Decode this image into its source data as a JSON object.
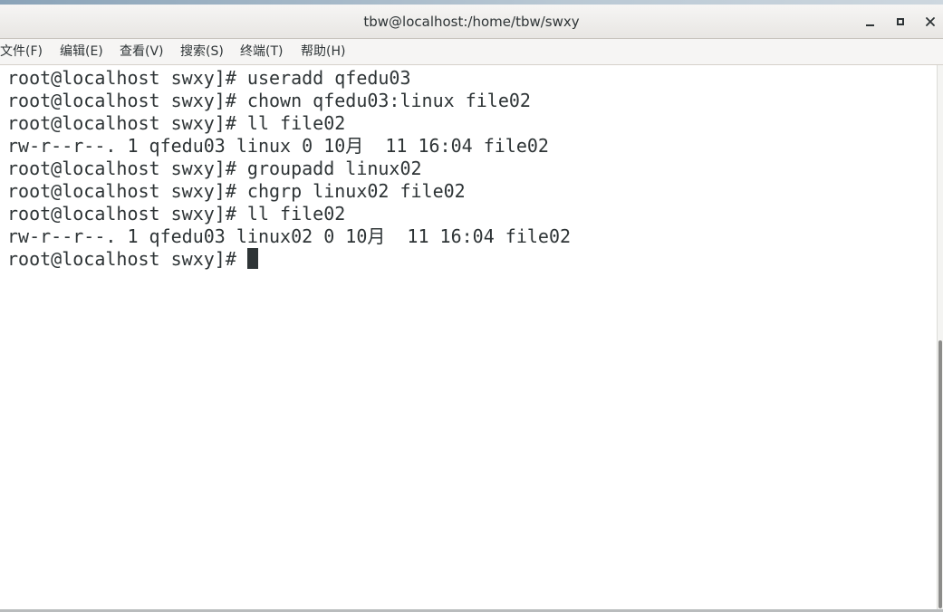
{
  "window": {
    "title": "tbw@localhost:/home/tbw/swxy",
    "controls": [
      "minimize-icon",
      "maximize-icon",
      "close-icon"
    ]
  },
  "menu": {
    "items": [
      {
        "label": "文件(F)"
      },
      {
        "label": "编辑(E)"
      },
      {
        "label": "查看(V)"
      },
      {
        "label": "搜索(S)"
      },
      {
        "label": "终端(T)"
      },
      {
        "label": "帮助(H)"
      }
    ]
  },
  "terminal": {
    "lines": [
      "root@localhost swxy]# useradd qfedu03",
      "root@localhost swxy]# chown qfedu03:linux file02",
      "root@localhost swxy]# ll file02",
      "rw-r--r--. 1 qfedu03 linux 0 10月  11 16:04 file02",
      "root@localhost swxy]# groupadd linux02",
      "root@localhost swxy]# chgrp linux02 file02",
      "root@localhost swxy]# ll file02",
      "rw-r--r--. 1 qfedu03 linux02 0 10月  11 16:04 file02",
      "root@localhost swxy]# "
    ]
  },
  "colors": {
    "background": "#ffffff",
    "text": "#2e3436",
    "titlebar": "#e8e6e3",
    "menubar": "#f6f5f4"
  }
}
